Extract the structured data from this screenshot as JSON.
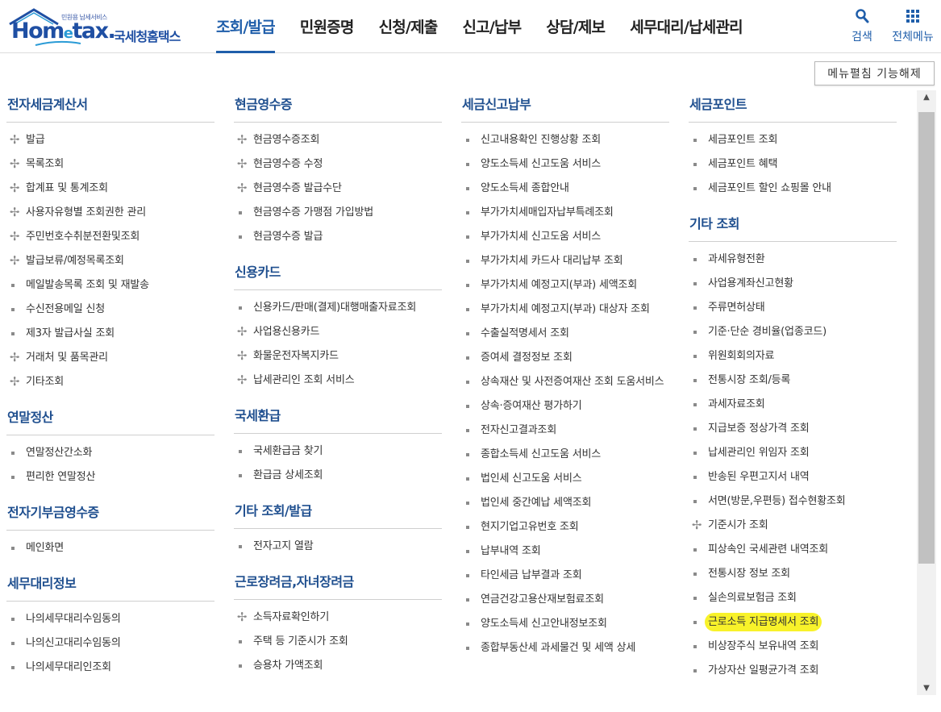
{
  "brand": {
    "small": "민원용 납세서비스",
    "word_a": "Hom",
    "word_e": "e",
    "word_b": "tax.",
    "korean": "국세청홈택스"
  },
  "gnb": [
    {
      "label": "조회/발급",
      "active": true
    },
    {
      "label": "민원증명"
    },
    {
      "label": "신청/제출"
    },
    {
      "label": "신고/납부"
    },
    {
      "label": "상담/제보"
    },
    {
      "label": "세무대리/납세관리"
    }
  ],
  "util": {
    "search_label": "검색",
    "all_menu_label": "전체메뉴"
  },
  "toggle_label": "메뉴펼침 기능해제",
  "columns": [
    [
      {
        "title": "전자세금계산서",
        "items": [
          {
            "label": "발급",
            "mark": "plus"
          },
          {
            "label": "목록조회",
            "mark": "plus"
          },
          {
            "label": "합계표 및 통계조회",
            "mark": "plus"
          },
          {
            "label": "사용자유형별 조회권한 관리",
            "mark": "plus"
          },
          {
            "label": "주민번호수취분전환및조회",
            "mark": "plus"
          },
          {
            "label": "발급보류/예정목록조회",
            "mark": "plus"
          },
          {
            "label": "메일발송목록 조회 및 재발송",
            "mark": "square"
          },
          {
            "label": "수신전용메일 신청",
            "mark": "square"
          },
          {
            "label": "제3자 발급사실 조회",
            "mark": "square"
          },
          {
            "label": "거래처 및 품목관리",
            "mark": "plus"
          },
          {
            "label": "기타조회",
            "mark": "plus"
          }
        ]
      },
      {
        "title": "연말정산",
        "items": [
          {
            "label": "연말정산간소화",
            "mark": "square"
          },
          {
            "label": "편리한 연말정산",
            "mark": "square"
          }
        ]
      },
      {
        "title": "전자기부금영수증",
        "items": [
          {
            "label": "메인화면",
            "mark": "square"
          }
        ]
      },
      {
        "title": "세무대리정보",
        "items": [
          {
            "label": "나의세무대리수임동의",
            "mark": "square"
          },
          {
            "label": "나의신고대리수임동의",
            "mark": "square"
          },
          {
            "label": "나의세무대리인조회",
            "mark": "square"
          }
        ]
      }
    ],
    [
      {
        "title": "현금영수증",
        "items": [
          {
            "label": "현금영수증조회",
            "mark": "plus"
          },
          {
            "label": "현금영수증 수정",
            "mark": "plus"
          },
          {
            "label": "현금영수증 발급수단",
            "mark": "plus"
          },
          {
            "label": "현금영수증 가맹점 가입방법",
            "mark": "square"
          },
          {
            "label": "현금영수증 발급",
            "mark": "square"
          }
        ]
      },
      {
        "title": "신용카드",
        "items": [
          {
            "label": "신용카드/판매(결제)대행매출자료조회",
            "mark": "square"
          },
          {
            "label": "사업용신용카드",
            "mark": "plus"
          },
          {
            "label": "화물운전자복지카드",
            "mark": "plus"
          },
          {
            "label": "납세관리인 조회 서비스",
            "mark": "plus"
          }
        ]
      },
      {
        "title": "국세환급",
        "items": [
          {
            "label": "국세환급금 찾기",
            "mark": "square"
          },
          {
            "label": "환급금 상세조회",
            "mark": "square"
          }
        ]
      },
      {
        "title": "기타 조회/발급",
        "items": [
          {
            "label": "전자고지 열람",
            "mark": "square"
          }
        ]
      },
      {
        "title": "근로장려금,자녀장려금",
        "items": [
          {
            "label": "소득자료확인하기",
            "mark": "plus"
          },
          {
            "label": "주택 등 기준시가 조회",
            "mark": "square"
          },
          {
            "label": "승용차 가액조회",
            "mark": "square"
          }
        ]
      }
    ],
    [
      {
        "title": "세금신고납부",
        "items": [
          {
            "label": "신고내용확인 진행상황 조회",
            "mark": "square"
          },
          {
            "label": "양도소득세 신고도움 서비스",
            "mark": "square"
          },
          {
            "label": "양도소득세 종합안내",
            "mark": "square"
          },
          {
            "label": "부가가치세매입자납부특례조회",
            "mark": "square"
          },
          {
            "label": "부가가치세 신고도움 서비스",
            "mark": "square"
          },
          {
            "label": "부가가치세 카드사 대리납부 조회",
            "mark": "square"
          },
          {
            "label": "부가가치세 예정고지(부과) 세액조회",
            "mark": "square"
          },
          {
            "label": "부가가치세 예정고지(부과) 대상자 조회",
            "mark": "square"
          },
          {
            "label": "수출실적명세서 조회",
            "mark": "square"
          },
          {
            "label": "증여세 결정정보 조회",
            "mark": "square"
          },
          {
            "label": "상속재산 및 사전증여재산 조회 도움서비스",
            "mark": "square"
          },
          {
            "label": "상속·증여재산 평가하기",
            "mark": "square"
          },
          {
            "label": "전자신고결과조회",
            "mark": "square"
          },
          {
            "label": "종합소득세 신고도움 서비스",
            "mark": "square"
          },
          {
            "label": "법인세 신고도움 서비스",
            "mark": "square"
          },
          {
            "label": "법인세 중간예납 세액조회",
            "mark": "square"
          },
          {
            "label": "현지기업고유번호 조회",
            "mark": "square"
          },
          {
            "label": "납부내역 조회",
            "mark": "square"
          },
          {
            "label": "타인세금 납부결과 조회",
            "mark": "square"
          },
          {
            "label": "연금건강고용산재보험료조회",
            "mark": "square"
          },
          {
            "label": "양도소득세 신고안내정보조회",
            "mark": "square"
          },
          {
            "label": "종합부동산세 과세물건 및 세액 상세",
            "mark": "square"
          }
        ]
      }
    ],
    [
      {
        "title": "세금포인트",
        "items": [
          {
            "label": "세금포인트 조회",
            "mark": "square"
          },
          {
            "label": "세금포인트 혜택",
            "mark": "square"
          },
          {
            "label": "세금포인트 할인 쇼핑몰 안내",
            "mark": "square"
          }
        ]
      },
      {
        "title": "기타 조회",
        "items": [
          {
            "label": "과세유형전환",
            "mark": "square"
          },
          {
            "label": "사업용계좌신고현황",
            "mark": "square"
          },
          {
            "label": "주류면허상태",
            "mark": "square"
          },
          {
            "label": "기준·단순 경비율(업종코드)",
            "mark": "square"
          },
          {
            "label": "위원회회의자료",
            "mark": "square"
          },
          {
            "label": "전통시장 조회/등록",
            "mark": "square"
          },
          {
            "label": "과세자료조회",
            "mark": "square"
          },
          {
            "label": "지급보증 정상가격 조회",
            "mark": "square"
          },
          {
            "label": "납세관리인 위임자 조회",
            "mark": "square"
          },
          {
            "label": "반송된 우편고지서 내역",
            "mark": "square"
          },
          {
            "label": "서면(방문,우편등) 접수현황조회",
            "mark": "square"
          },
          {
            "label": "기준시가 조회",
            "mark": "plus"
          },
          {
            "label": "피상속인 국세관련 내역조회",
            "mark": "square"
          },
          {
            "label": "전통시장 정보 조회",
            "mark": "square"
          },
          {
            "label": "실손의료보험금 조회",
            "mark": "square"
          },
          {
            "label": "근로소득 지급명세서 조회",
            "mark": "square",
            "highlight": true
          },
          {
            "label": "비상장주식 보유내역 조회",
            "mark": "square"
          },
          {
            "label": "가상자산 일평균가격 조회",
            "mark": "square"
          }
        ]
      }
    ]
  ],
  "icons": {
    "search": "search-icon",
    "all_menu": "grid-icon",
    "plus": "plus-icon",
    "bullet": "square-bullet-icon"
  },
  "colors": {
    "brand": "#1f4fa3",
    "active_tab": "#1f5eaa",
    "section_title": "#1f4f8f",
    "highlight": "#f8f22a"
  }
}
